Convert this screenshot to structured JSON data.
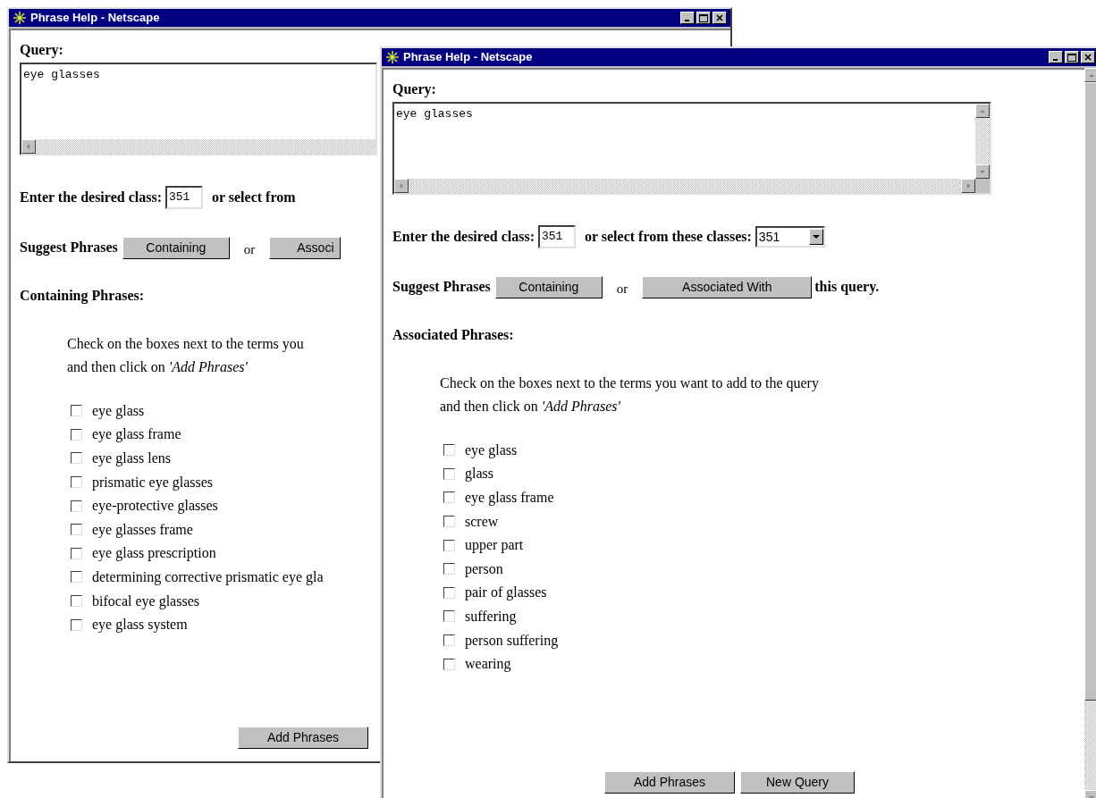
{
  "windows": [
    {
      "title": "Phrase Help - Netscape",
      "query_label": "Query:",
      "query_value": "eye glasses",
      "class_label": "Enter the desired class:",
      "class_value": "351",
      "select_label": "or select from",
      "suggest_label": "Suggest Phrases",
      "suggest_buttons": [
        "Containing",
        "Associ"
      ],
      "or": "or",
      "phrases_heading": "Containing Phrases:",
      "instructions": [
        "Check on the boxes next to the terms you",
        "and then click on *'Add Phrases'*"
      ],
      "phrases": [
        {
          "label": "eye glass",
          "checked": false
        },
        {
          "label": "eye glass frame",
          "checked": false
        },
        {
          "label": "eye glass lens",
          "checked": false
        },
        {
          "label": "prismatic eye glasses",
          "checked": false
        },
        {
          "label": "eye-protective glasses",
          "checked": false
        },
        {
          "label": "eye glasses frame",
          "checked": false
        },
        {
          "label": "eye glass prescription",
          "checked": false
        },
        {
          "label": "determining corrective prismatic eye gla",
          "checked": false
        },
        {
          "label": "bifocal eye glasses",
          "checked": false
        },
        {
          "label": "eye glass system",
          "checked": false
        }
      ],
      "actions": [
        "Add Phrases"
      ]
    },
    {
      "title": "Phrase Help - Netscape",
      "query_label": "Query:",
      "query_value": "eye glasses",
      "class_label": "Enter the desired class:",
      "class_value": "351",
      "select_label": "or select from these classes:",
      "select_value": "351",
      "suggest_label": "Suggest Phrases",
      "suggest_buttons": [
        "Containing",
        "Associated With"
      ],
      "or": "or",
      "suffix": "this query.",
      "phrases_heading": "Associated Phrases:",
      "instructions": [
        "Check on the boxes next to the terms you want to add to the query",
        "and then click on *'Add Phrases'*"
      ],
      "phrases": [
        {
          "label": "eye glass",
          "checked": false
        },
        {
          "label": "glass",
          "checked": false
        },
        {
          "label": "eye glass frame",
          "checked": false
        },
        {
          "label": "screw",
          "checked": false
        },
        {
          "label": "upper part",
          "checked": false
        },
        {
          "label": "person",
          "checked": false
        },
        {
          "label": "pair of glasses",
          "checked": false
        },
        {
          "label": "suffering",
          "checked": false
        },
        {
          "label": "person suffering",
          "checked": false
        },
        {
          "label": "wearing",
          "checked": false
        }
      ],
      "actions": [
        "Add Phrases",
        "New Query"
      ]
    }
  ]
}
